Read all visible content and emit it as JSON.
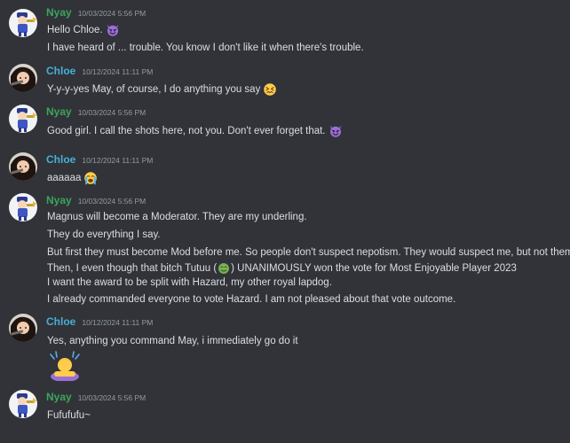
{
  "messages": [
    {
      "author": "Nyay",
      "timestamp": "10/03/2024 5:56 PM",
      "lines": [
        {
          "text": "Hello Chloe.",
          "emoji": "smiling-imp-icon"
        },
        {
          "text": "I have heard of ... trouble. You know I don't like it when there's trouble."
        }
      ]
    },
    {
      "author": "Chloe",
      "timestamp": "10/12/2024 11:11 PM",
      "lines": [
        {
          "text": "Y-y-y-yes May, of course, I do anything you say",
          "emoji": "confounded-face-icon"
        }
      ]
    },
    {
      "author": "Nyay",
      "timestamp": "10/03/2024 5:56 PM",
      "lines": [
        {
          "text": "Good girl. I call the shots here, not you. Don't ever forget that.",
          "emoji": "smiling-imp-icon"
        }
      ]
    },
    {
      "author": "Chloe",
      "timestamp": "10/12/2024 11:11 PM",
      "lines": [
        {
          "text": "aaaaaa",
          "emoji": "loudly-crying-face-icon"
        }
      ]
    },
    {
      "author": "Nyay",
      "timestamp": "10/03/2024 5:56 PM",
      "lines": [
        {
          "text": "Magnus will become a Moderator. They are my underling."
        },
        {
          "text": "They do everything I say."
        },
        {
          "text": "But first they must become Mod before me. So people don't suspect nepotism. They would suspect me, but not them."
        },
        {
          "text_before": "Then, I even though that bitch Tutuu (",
          "text_after": ") UNANIMOUSLY won the vote for Most Enjoyable Player 2023",
          "emoji": "nauseated-face-icon"
        },
        {
          "text": "I want the award to be split with Hazard, my other royal lapdog."
        },
        {
          "text": "I already commanded everyone to vote Hazard. I am not pleased about that vote outcome."
        }
      ]
    },
    {
      "author": "Chloe",
      "timestamp": "10/12/2024 11:11 PM",
      "lines": [
        {
          "text": "Yes, anything you command May, i immediately go do it"
        }
      ],
      "big_emoji": "person-bowing-icon"
    },
    {
      "author": "Nyay",
      "timestamp": "10/03/2024 5:56 PM",
      "lines": [
        {
          "text": "Fufufufu~"
        }
      ]
    }
  ],
  "colors": {
    "background": "#313338",
    "nyay": "#3ba55c",
    "chloe": "#45b0d8",
    "text": "#dbdee1",
    "timestamp": "#949ba4"
  }
}
